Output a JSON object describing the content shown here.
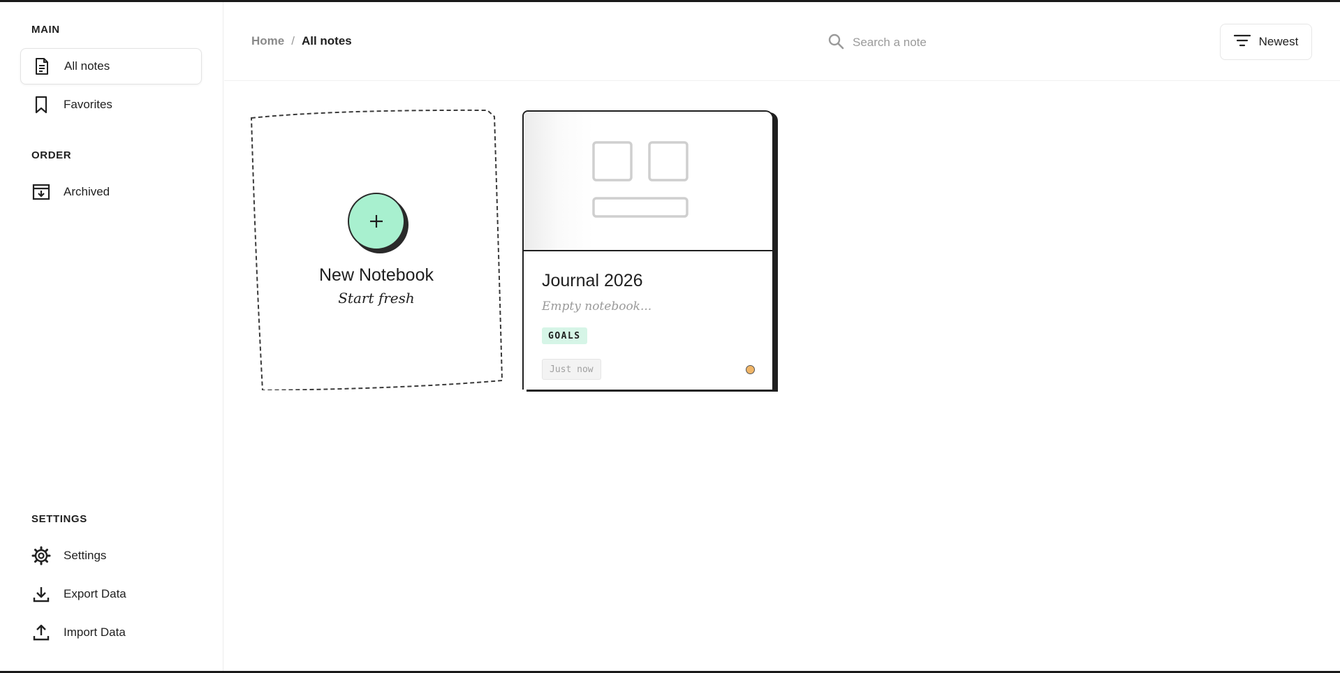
{
  "sidebar": {
    "main_label": "MAIN",
    "order_label": "ORDER",
    "settings_label": "SETTINGS",
    "items": [
      {
        "label": "All notes",
        "icon": "document-icon"
      },
      {
        "label": "Favorites",
        "icon": "bookmark-icon"
      },
      {
        "label": "Archived",
        "icon": "archive-icon"
      },
      {
        "label": "Settings",
        "icon": "gear-icon"
      },
      {
        "label": "Export Data",
        "icon": "download-icon"
      },
      {
        "label": "Import Data",
        "icon": "upload-icon"
      }
    ],
    "active_item": "All notes"
  },
  "header": {
    "breadcrumb": {
      "home": "Home",
      "separator": "/",
      "current": "All notes"
    },
    "search": {
      "placeholder": "Search a note",
      "value": ""
    },
    "sort": {
      "label": "Newest",
      "icon": "filter-lines-icon"
    }
  },
  "new_notebook": {
    "title": "New Notebook",
    "subtitle": "Start fresh",
    "icon": "plus-icon",
    "accent": "#a8f0cf"
  },
  "notes": [
    {
      "title": "Journal 2026",
      "description": "Empty notebook...",
      "tag": "GOALS",
      "tag_color": "#d6f5e7",
      "timestamp": "Just now",
      "status_color": "#f0b567",
      "thumbnail_icon": "layout-placeholder-icon"
    }
  ]
}
